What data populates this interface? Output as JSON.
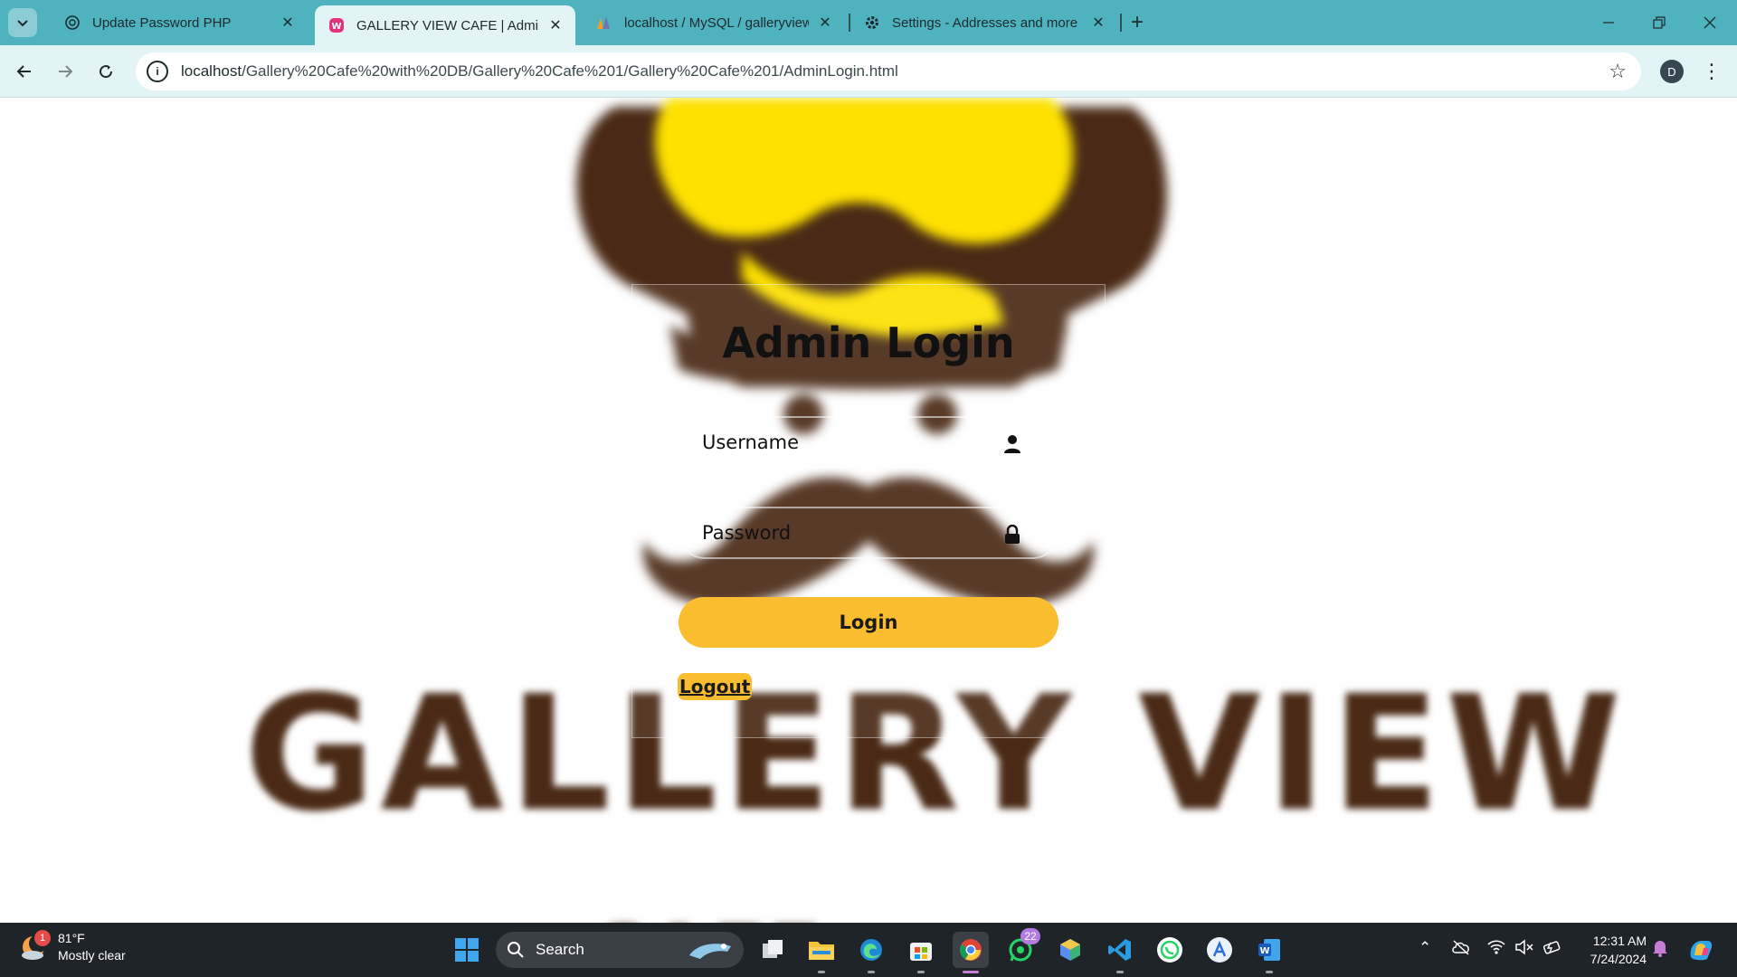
{
  "browser": {
    "tabs": [
      {
        "title": "Update Password PHP",
        "favicon": "chatgpt-icon"
      },
      {
        "title": "GALLERY VIEW CAFE | AdminLo",
        "favicon": "app-icon",
        "active": true
      },
      {
        "title": "localhost / MySQL / galleryview",
        "favicon": "phpmyadmin-icon"
      },
      {
        "title": "Settings - Addresses and more",
        "favicon": "gear-icon"
      }
    ],
    "url_host": "localhost",
    "url_path": "/Gallery%20Cafe%20with%20DB/Gallery%20Cafe%201/Gallery%20Cafe%201/AdminLogin.html",
    "profile_initial": "D",
    "accent": "#4fb3bf"
  },
  "page": {
    "bg_text": "GALLERY VIEW",
    "title": "Admin Login",
    "username_placeholder": "Username",
    "password_placeholder": "Password",
    "login_label": "Login",
    "logout_label": "Logout",
    "button_color": "#fbbd30"
  },
  "taskbar": {
    "weather_temp": "81°F",
    "weather_desc": "Mostly clear",
    "weather_badge": "1",
    "search_label": "Search",
    "whatsapp_badge": "22",
    "time": "12:31 AM",
    "date": "7/24/2024"
  }
}
